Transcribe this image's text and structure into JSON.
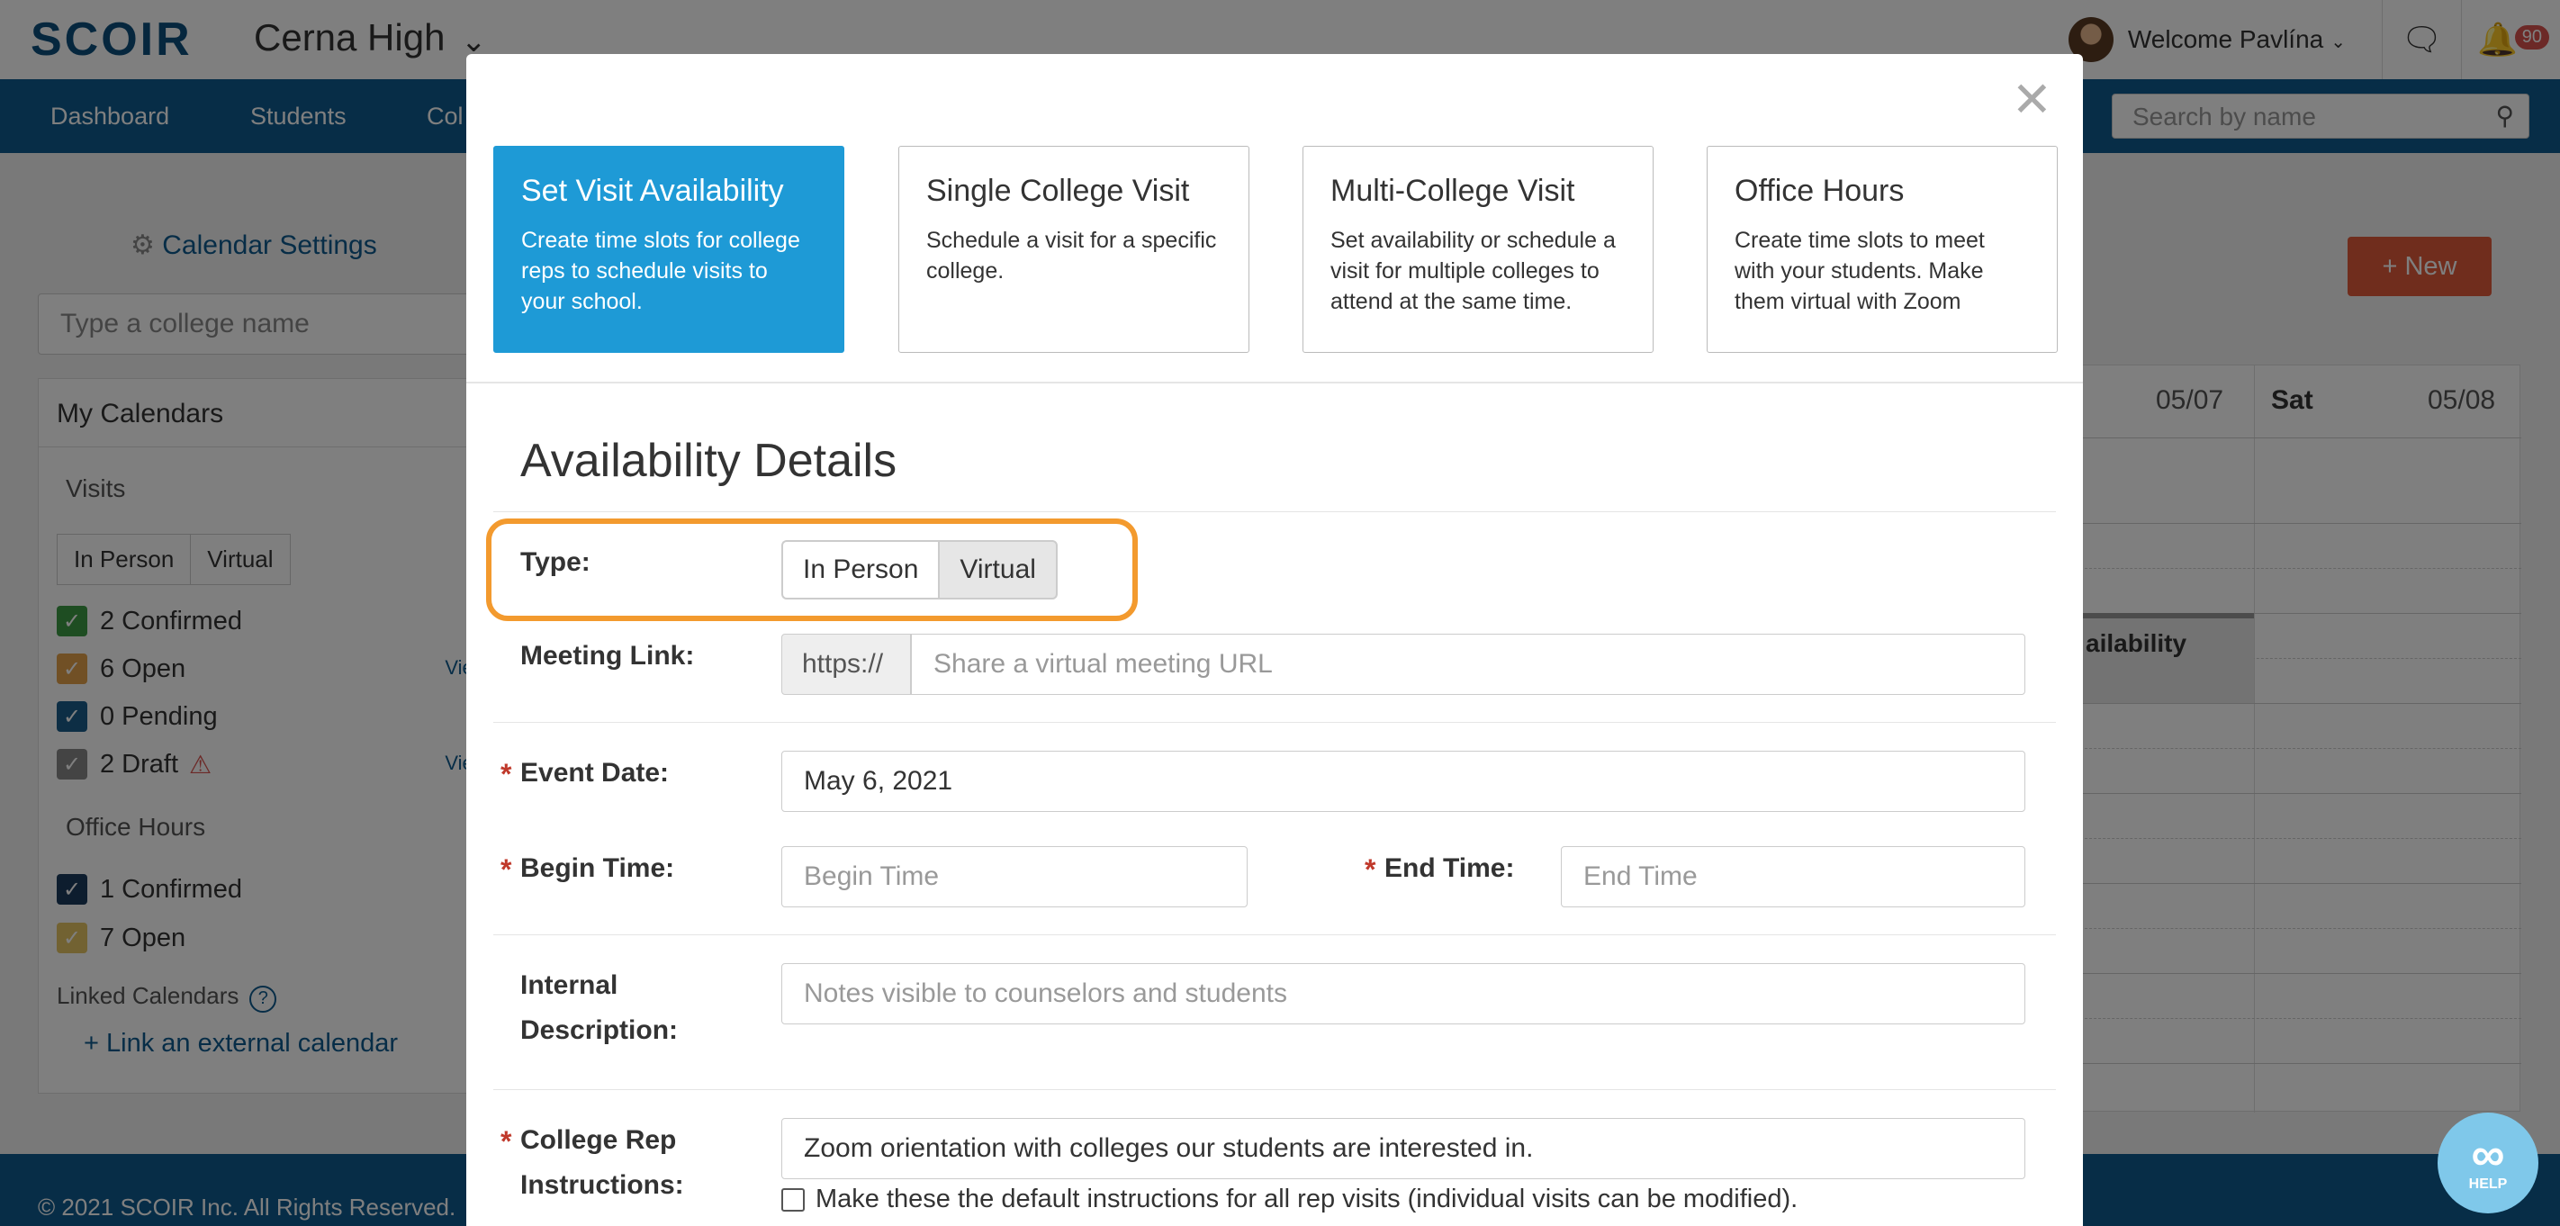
{
  "header": {
    "logo": "SCOIR",
    "school": "Cerna High",
    "welcome": "Welcome Pavlína",
    "notifications": "90"
  },
  "nav": {
    "items": [
      "Dashboard",
      "Students",
      "Col"
    ],
    "search_placeholder": "Search by name"
  },
  "sidebar": {
    "settings": "Calendar Settings",
    "college_placeholder": "Type a college name",
    "my_calendars": "My Calendars",
    "visits_label": "Visits",
    "visits_tabs": [
      "In Person",
      "Virtual"
    ],
    "visits": [
      {
        "label": "2 Confirmed",
        "color": "#3c9a44"
      },
      {
        "label": "6 Open",
        "color": "#e2a04a"
      },
      {
        "label": "0 Pending",
        "color": "#1a5d8a"
      },
      {
        "label": "2 Draft",
        "color": "#888888"
      }
    ],
    "view_all": "View All",
    "office_hours_label": "Office Hours",
    "office_hours": [
      {
        "label": "1 Confirmed",
        "color": "#1b3a5c"
      },
      {
        "label": "7 Open",
        "color": "#e5c464"
      }
    ],
    "linked_calendars": "Linked Calendars",
    "link_external": "Link an external calendar"
  },
  "calendar": {
    "new_button": "New",
    "date_col1": "05/07",
    "day_col2": "Sat",
    "date_col2": "05/08",
    "block_text": "ailability"
  },
  "footer": {
    "copyright": "© 2021 SCOIR Inc. All Rights Reserved."
  },
  "modal": {
    "cards": [
      {
        "title": "Set Visit Availability",
        "desc": "Create time slots for college reps to schedule visits to your school."
      },
      {
        "title": "Single College Visit",
        "desc": "Schedule a visit for a specific college."
      },
      {
        "title": "Multi-College Visit",
        "desc": "Set availability or schedule a visit for multiple colleges to attend at the same time."
      },
      {
        "title": "Office Hours",
        "desc": "Create time slots to meet with your students. Make them virtual with Zoom"
      }
    ],
    "section_title": "Availability Details",
    "type_label": "Type:",
    "type_options": [
      "In Person",
      "Virtual"
    ],
    "meeting_link_label": "Meeting Link:",
    "meeting_prefix": "https://",
    "meeting_placeholder": "Share a virtual meeting URL",
    "event_date_label": "Event Date:",
    "event_date_value": "May 6, 2021",
    "begin_time_label": "Begin Time:",
    "begin_time_placeholder": "Begin Time",
    "end_time_label": "End Time:",
    "end_time_placeholder": "End Time",
    "internal_label_1": "Internal",
    "internal_label_2": "Description:",
    "internal_placeholder": "Notes visible to counselors and students",
    "rep_label_1": "College Rep",
    "rep_label_2": "Instructions:",
    "rep_value": "Zoom orientation with colleges our students are interested in.",
    "default_checkbox": "Make these the default instructions for all rep visits (individual visits can be modified).",
    "required_mark": "*"
  },
  "help": {
    "label": "HELP"
  }
}
